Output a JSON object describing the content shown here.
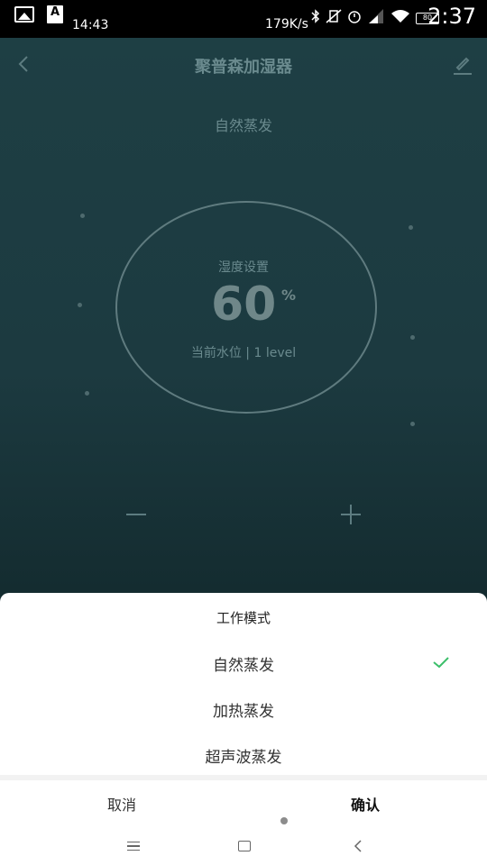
{
  "status_bar": {
    "time_small": "14:43",
    "net_speed": "179K/s",
    "time_big": "2:37",
    "battery": "80",
    "icons": [
      "image-icon",
      "a-notification-icon",
      "bluetooth-icon",
      "vibrate-icon",
      "alarm-icon",
      "signal-icon",
      "wifi-icon",
      "battery-icon"
    ]
  },
  "app": {
    "title": "聚普森加湿器",
    "current_mode": "自然蒸发",
    "dial": {
      "label": "湿度设置",
      "value": "60",
      "unit": "%",
      "status": "当前水位 | 1 level"
    }
  },
  "sheet": {
    "title": "工作模式",
    "options": [
      {
        "label": "自然蒸发",
        "selected": true
      },
      {
        "label": "加热蒸发",
        "selected": false
      },
      {
        "label": "超声波蒸发",
        "selected": false
      }
    ],
    "cancel_label": "取消",
    "confirm_label": "确认"
  },
  "colors": {
    "accent_check": "#3cbf6a",
    "app_bg": "#1e3f44"
  }
}
